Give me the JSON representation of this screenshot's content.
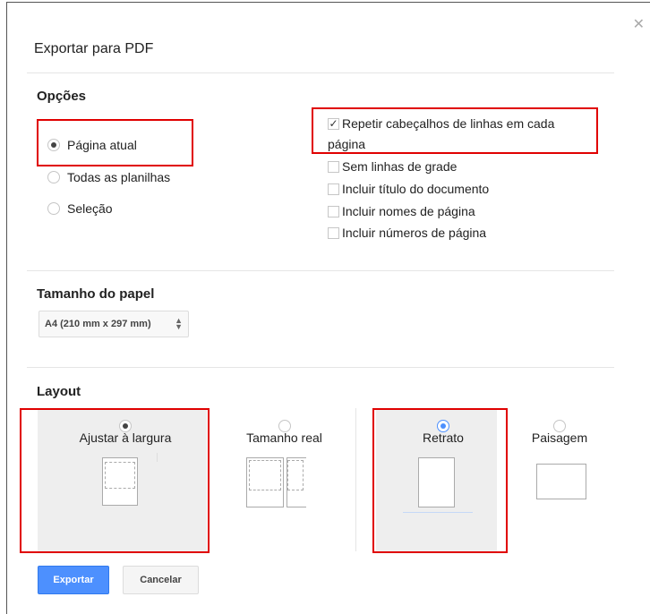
{
  "dialog": {
    "title": "Exportar para PDF",
    "close_icon": "close-icon"
  },
  "options": {
    "heading": "Opções",
    "radios": [
      {
        "label": "Página atual",
        "checked": true
      },
      {
        "label": "Todas as planilhas",
        "checked": false
      },
      {
        "label": "Seleção",
        "checked": false
      }
    ],
    "checkboxes": [
      {
        "label_line1": "Repetir cabeçalhos de linhas em cada",
        "label_line2": "página",
        "checked": true
      },
      {
        "label": "Sem linhas de grade",
        "checked": false
      },
      {
        "label": "Incluir título do documento",
        "checked": false
      },
      {
        "label": "Incluir nomes de página",
        "checked": false
      },
      {
        "label": "Incluir números de página",
        "checked": false
      }
    ]
  },
  "paper": {
    "heading": "Tamanho do papel",
    "selected": "A4 (210 mm x 297 mm)"
  },
  "layout": {
    "heading": "Layout",
    "fit": [
      {
        "label": "Ajustar à largura",
        "checked": true
      },
      {
        "label": "Tamanho real",
        "checked": false
      }
    ],
    "orientation": [
      {
        "label": "Retrato",
        "checked": true
      },
      {
        "label": "Paisagem",
        "checked": false
      }
    ]
  },
  "buttons": {
    "export_label": "Exportar",
    "cancel_label": "Cancelar"
  },
  "colors": {
    "accent": "#4d90fe",
    "highlight_box": "#e00000"
  }
}
